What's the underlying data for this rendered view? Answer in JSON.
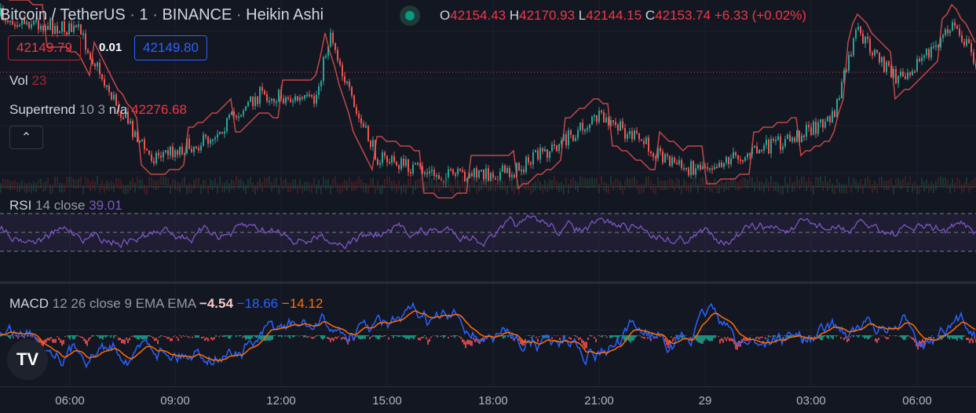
{
  "header": {
    "symbol": "Bitcoin / TetherUS",
    "interval": "1",
    "exchange": "BINANCE",
    "chart_type": "Heikin Ashi",
    "sep": "·",
    "o_label": "O",
    "o": "42154.43",
    "h_label": "H",
    "h": "42170.93",
    "l_label": "L",
    "l": "42144.15",
    "c_label": "C",
    "c": "42153.74",
    "change": "+6.33 (+0.02%)"
  },
  "trade": {
    "sell_price": "42149.79",
    "spread": "0.01",
    "buy_price": "42149.80"
  },
  "indicators": {
    "vol": {
      "name": "Vol",
      "value": "23"
    },
    "supertrend": {
      "name": "Supertrend",
      "params": "10 3",
      "value1": "n/a",
      "value2": "42276.68"
    },
    "rsi": {
      "name": "RSI",
      "params": "14 close",
      "value": "39.01"
    },
    "macd": {
      "name": "MACD",
      "params": "12 26 close 9 EMA EMA",
      "hist": "−4.54",
      "macd": "−18.66",
      "signal": "−14.12"
    }
  },
  "collapse_icon": "chevron-up-icon",
  "time_axis": [
    "06:00",
    "09:00",
    "12:00",
    "15:00",
    "18:00",
    "21:00",
    "29",
    "03:00",
    "06:00"
  ],
  "colors": {
    "up": "#26a69a",
    "down": "#ef5350",
    "rsi": "#7e57c2",
    "macd": "#2962ff",
    "signal": "#ff6d00",
    "bg": "#131722"
  }
}
